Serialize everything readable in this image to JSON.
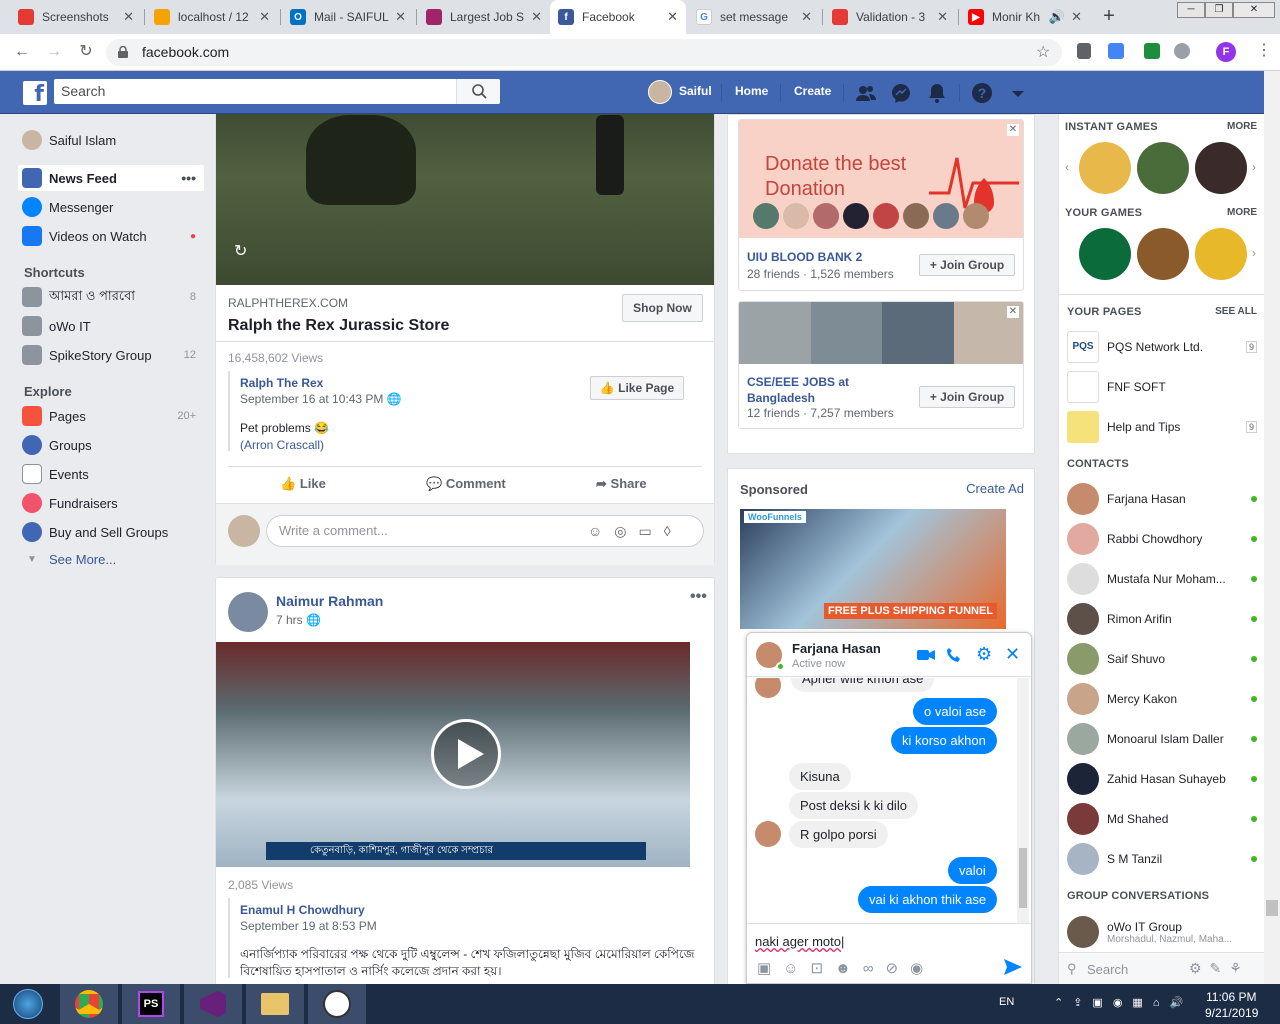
{
  "browser": {
    "tabs": [
      {
        "title": "Screenshots",
        "color": "#e53935"
      },
      {
        "title": "localhost / 12",
        "color": "#f4a300"
      },
      {
        "title": "Mail - SAIFUL",
        "color": "#0072c6"
      },
      {
        "title": "Largest Job S",
        "color": "#a0246a"
      },
      {
        "title": "Facebook",
        "color": "#3b5998",
        "active": true
      },
      {
        "title": "set message",
        "color": "#4285f4"
      },
      {
        "title": "Validation - 3",
        "color": "#e53935"
      },
      {
        "title": "Monir Kh",
        "color": "#ff0000"
      }
    ],
    "url": "facebook.com",
    "profile_initial": "F"
  },
  "fb_header": {
    "search_placeholder": "Search",
    "user_name": "Saiful",
    "home": "Home",
    "create": "Create"
  },
  "left_nav": {
    "user": "Saiful Islam",
    "news_feed": "News Feed",
    "messenger": "Messenger",
    "videos": "Videos on Watch",
    "shortcuts_title": "Shortcuts",
    "shortcuts": [
      {
        "label": "আমরা ও পারবো",
        "count": "8"
      },
      {
        "label": "oWo IT",
        "count": ""
      },
      {
        "label": "SpikeStory Group",
        "count": "12"
      }
    ],
    "explore_title": "Explore",
    "explore": [
      {
        "label": "Pages",
        "count": "20+"
      },
      {
        "label": "Groups",
        "count": ""
      },
      {
        "label": "Events",
        "count": ""
      },
      {
        "label": "Fundraisers",
        "count": ""
      },
      {
        "label": "Buy and Sell Groups",
        "count": ""
      }
    ],
    "see_more": "See More..."
  },
  "post1": {
    "domain": "RALPHTHEREX.COM",
    "title": "Ralph the Rex Jurassic Store",
    "shop_now": "Shop Now",
    "views": "16,458,602 Views",
    "page_name": "Ralph The Rex",
    "date": "September 16 at 10:43 PM",
    "like_page": "Like Page",
    "text": "Pet problems 😂",
    "credit": "(Arron Crascall)",
    "like": "Like",
    "comment": "Comment",
    "share": "Share",
    "comment_placeholder": "Write a comment..."
  },
  "post2": {
    "author": "Naimur Rahman",
    "time": "7 hrs",
    "views": "2,085 Views",
    "source": "Enamul H Chowdhury",
    "date": "September 19 at 8:53 PM",
    "text": "এনার্জিপ্যাক পরিবারের পক্ষ থেকে দুটি এম্বুলেন্স - শেখ ফজিলাতুন্নেছা মুজিব মেমোরিয়াল কেপিজে বিশেষায়িত হাসপাতাল ও নার্সিং কলেজে প্রদান করা হয়।",
    "video_caption": "কেতুনবাড়ি, কাশিমপুর, গাজীপুর থেকে সম্প্রচার"
  },
  "groups": [
    {
      "banner_text": "Donate the best Donation",
      "name": "UIU BLOOD BANK 2",
      "meta": "28 friends · 1,526 members",
      "join": "Join Group"
    },
    {
      "name": "CSE/EEE JOBS at Bangladesh",
      "meta": "12 friends · 7,257 members",
      "join": "Join Group"
    }
  ],
  "sponsored": {
    "title": "Sponsored",
    "create_ad": "Create Ad",
    "ad_brand": "WooFunnels",
    "ad_banner": "FREE PLUS SHIPPING FUNNEL"
  },
  "right_rail": {
    "instant_games": "INSTANT GAMES",
    "your_games": "YOUR GAMES",
    "more": "MORE",
    "your_pages": "YOUR PAGES",
    "see_all": "SEE ALL",
    "pages": [
      {
        "name": "PQS Network Ltd.",
        "badge": "9"
      },
      {
        "name": "FNF SOFT",
        "badge": ""
      },
      {
        "name": "Help and Tips",
        "badge": "9"
      }
    ],
    "contacts_title": "CONTACTS",
    "contacts": [
      "Farjana Hasan",
      "Rabbi Chowdhory",
      "Mustafa Nur Moham...",
      "Rimon Arifin",
      "Saif Shuvo",
      "Mercy Kakon",
      "Monoarul Islam Daller",
      "Zahid Hasan Suhayeb",
      "Md Shahed",
      "S M Tanzil"
    ],
    "group_conv_title": "GROUP CONVERSATIONS",
    "group_name": "oWo IT Group",
    "group_members": "Morshadul, Nazmul, Maha...",
    "search_placeholder": "Search"
  },
  "chat": {
    "name": "Farjana Hasan",
    "status": "Active now",
    "partial": "Apner wife kmon ase",
    "messages": [
      {
        "from": "me",
        "text": "o valoi ase"
      },
      {
        "from": "me",
        "text": "ki korso akhon"
      },
      {
        "from": "them",
        "text": "Kisuna"
      },
      {
        "from": "them",
        "text": "Post deksi k ki dilo"
      },
      {
        "from": "them",
        "text": "R golpo porsi"
      },
      {
        "from": "me",
        "text": "valoi"
      },
      {
        "from": "me",
        "text": "vai ki akhon thik ase"
      }
    ],
    "input_value": "naki ager moto"
  },
  "taskbar": {
    "lang": "EN",
    "time": "11:06 PM",
    "date": "9/21/2019"
  }
}
